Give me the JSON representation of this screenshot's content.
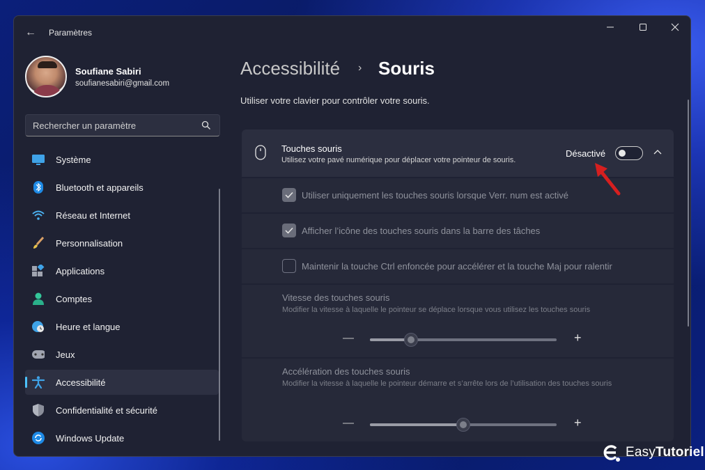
{
  "window": {
    "title": "Paramètres",
    "back_label": "←"
  },
  "profile": {
    "name": "Soufiane Sabiri",
    "email": "soufianesabiri@gmail.com"
  },
  "search": {
    "placeholder": "Rechercher un paramètre"
  },
  "sidebar": {
    "items": [
      {
        "label": "Système",
        "icon": "monitor-icon",
        "active": false
      },
      {
        "label": "Bluetooth et appareils",
        "icon": "bluetooth-icon",
        "active": false
      },
      {
        "label": "Réseau et Internet",
        "icon": "wifi-icon",
        "active": false
      },
      {
        "label": "Personnalisation",
        "icon": "brush-icon",
        "active": false
      },
      {
        "label": "Applications",
        "icon": "apps-icon",
        "active": false
      },
      {
        "label": "Comptes",
        "icon": "person-icon",
        "active": false
      },
      {
        "label": "Heure et langue",
        "icon": "globe-clock-icon",
        "active": false
      },
      {
        "label": "Jeux",
        "icon": "gamepad-icon",
        "active": false
      },
      {
        "label": "Accessibilité",
        "icon": "accessibility-icon",
        "active": true
      },
      {
        "label": "Confidentialité et sécurité",
        "icon": "shield-icon",
        "active": false
      },
      {
        "label": "Windows Update",
        "icon": "update-icon",
        "active": false
      }
    ]
  },
  "breadcrumb": {
    "parent": "Accessibilité",
    "separator": "›",
    "current": "Souris"
  },
  "main": {
    "description": "Utiliser votre clavier pour contrôler votre souris.",
    "mouse_keys": {
      "title": "Touches souris",
      "subtitle": "Utilisez votre pavé numérique pour déplacer votre pointeur de souris.",
      "toggle_label": "Désactivé",
      "toggle_on": false
    },
    "options": [
      {
        "label": "Utiliser uniquement les touches souris lorsque Verr. num est activé",
        "checked": true
      },
      {
        "label": "Afficher l’icône des touches souris dans la barre des tâches",
        "checked": true
      },
      {
        "label": "Maintenir la touche Ctrl enfoncée pour accélérer et la touche Maj pour ralentir",
        "checked": false
      }
    ],
    "speed": {
      "title": "Vitesse des touches souris",
      "subtitle": "Modifier la vitesse à laquelle le pointeur se déplace lorsque vous utilisez les touches souris",
      "value_fraction": 0.22
    },
    "acceleration": {
      "title": "Accélération des touches souris",
      "subtitle": "Modifier la vitesse à laquelle le pointeur démarre et s’arrête lors de l’utilisation des touches souris",
      "value_fraction": 0.5
    },
    "slider_minus": "—",
    "slider_plus": "+"
  },
  "watermark": {
    "text_regular": "Easy",
    "text_bold": "Tutoriel"
  },
  "colors": {
    "accent": "#4cc2ff",
    "annotation_arrow": "#d61f1f"
  }
}
